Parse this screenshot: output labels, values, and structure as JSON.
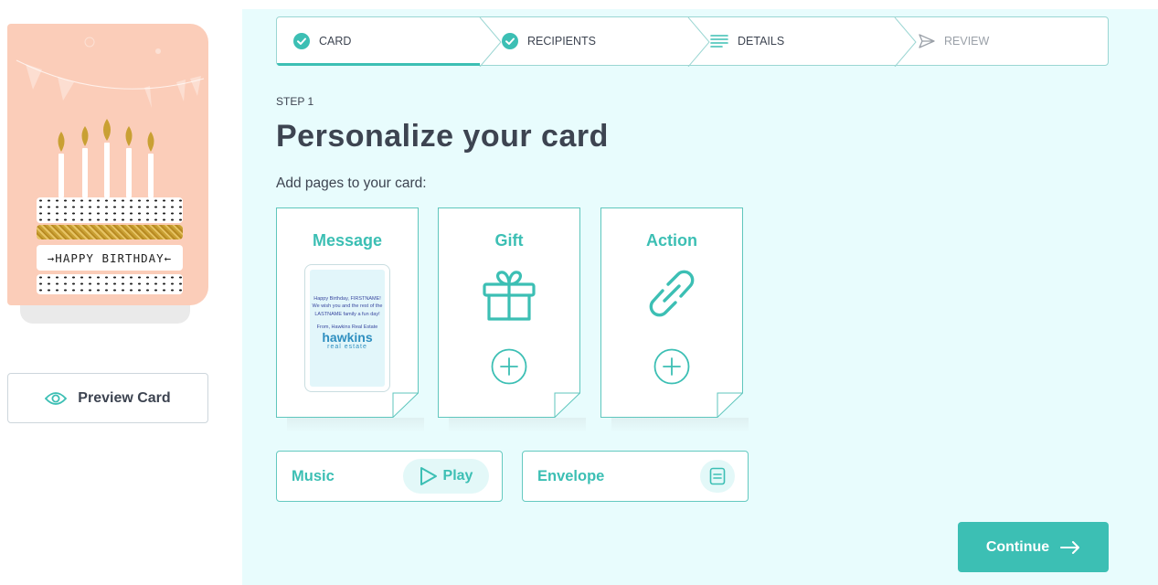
{
  "card_preview": {
    "cake_text": "→HAPPY BIRTHDAY←",
    "preview_button_label": "Preview Card",
    "preview_icon": "eye-icon"
  },
  "stepper": {
    "steps": [
      {
        "label": "CARD",
        "icon": "check-circle-icon",
        "state": "completed"
      },
      {
        "label": "RECIPIENTS",
        "icon": "check-circle-icon",
        "state": "completed"
      },
      {
        "label": "DETAILS",
        "icon": "list-icon",
        "state": "current"
      },
      {
        "label": "REVIEW",
        "icon": "send-icon",
        "state": "upcoming"
      }
    ]
  },
  "header": {
    "step_label": "STEP 1",
    "title": "Personalize your card",
    "subtitle": "Add pages to your card:"
  },
  "pages": {
    "message": {
      "title": "Message",
      "preview_text": "Happy Birthday, FIRSTNAME! We wish you and the rest of the LASTNAME family a fun day!",
      "preview_from": "From, Hawkins Real Estate",
      "logo_name": "hawkins",
      "logo_sub": "real estate"
    },
    "gift": {
      "title": "Gift",
      "icon": "gift-icon",
      "add_icon": "plus-circle-icon"
    },
    "action": {
      "title": "Action",
      "icon": "link-icon",
      "add_icon": "plus-circle-icon"
    }
  },
  "extras": {
    "music": {
      "label": "Music",
      "play_label": "Play",
      "icon": "play-icon"
    },
    "envelope": {
      "label": "Envelope",
      "icon": "envelope-icon"
    }
  },
  "footer": {
    "continue_label": "Continue",
    "icon": "arrow-right-icon"
  },
  "colors": {
    "accent": "#3cbfb4",
    "panel_bg": "#e8fcfd",
    "card_pink": "#fbcdb9",
    "text": "#3d4451"
  }
}
